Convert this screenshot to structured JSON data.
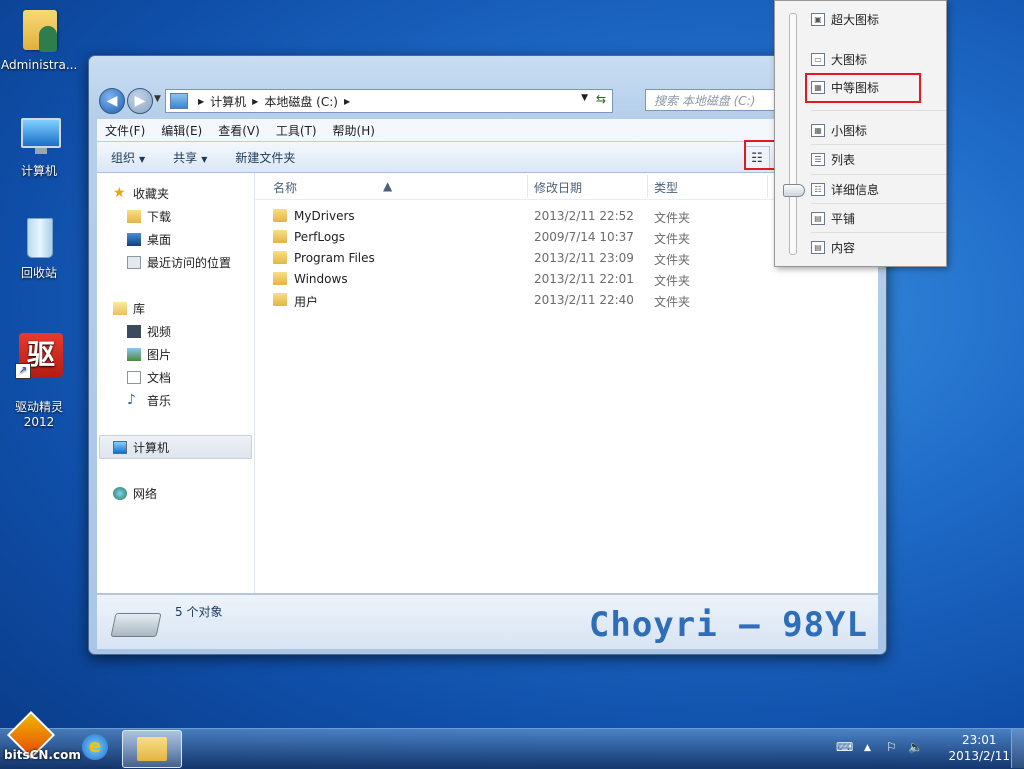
{
  "desktop": {
    "icons": [
      {
        "label": "Administra..."
      },
      {
        "label": "计算机"
      },
      {
        "label": "回收站"
      },
      {
        "label": "驱动精灵\n2012",
        "glyph": "驱"
      }
    ]
  },
  "explorer": {
    "address": {
      "crumbs": [
        "计算机",
        "本地磁盘 (C:)"
      ],
      "search_placeholder": "搜索 本地磁盘 (C:)"
    },
    "menu": [
      "文件(F)",
      "编辑(E)",
      "查看(V)",
      "工具(T)",
      "帮助(H)"
    ],
    "toolbar": {
      "organize": "组织",
      "share": "共享",
      "new_folder": "新建文件夹"
    },
    "nav": {
      "favorites": "收藏夹",
      "fav_items": [
        "下载",
        "桌面",
        "最近访问的位置"
      ],
      "libraries": "库",
      "lib_items": [
        "视频",
        "图片",
        "文档",
        "音乐"
      ],
      "computer": "计算机",
      "network": "网络"
    },
    "columns": {
      "name": "名称",
      "date": "修改日期",
      "type": "类型"
    },
    "files": [
      {
        "name": "MyDrivers",
        "date": "2013/2/11 22:52",
        "type": "文件夹"
      },
      {
        "name": "PerfLogs",
        "date": "2009/7/14 10:37",
        "type": "文件夹"
      },
      {
        "name": "Program Files",
        "date": "2013/2/11 23:09",
        "type": "文件夹"
      },
      {
        "name": "Windows",
        "date": "2013/2/11 22:01",
        "type": "文件夹"
      },
      {
        "name": "用户",
        "date": "2013/2/11 22:40",
        "type": "文件夹"
      }
    ],
    "status": "5 个对象",
    "watermark": "Choyri — 98YL"
  },
  "view_menu": {
    "items": [
      "超大图标",
      "大图标",
      "中等图标",
      "小图标",
      "列表",
      "详细信息",
      "平铺",
      "内容"
    ]
  },
  "taskbar": {
    "brand": "bitsCN.com",
    "time": "23:01",
    "date": "2013/2/11"
  },
  "colors": {
    "highlight": "#e2191f",
    "watermark": "#2e6db8"
  }
}
